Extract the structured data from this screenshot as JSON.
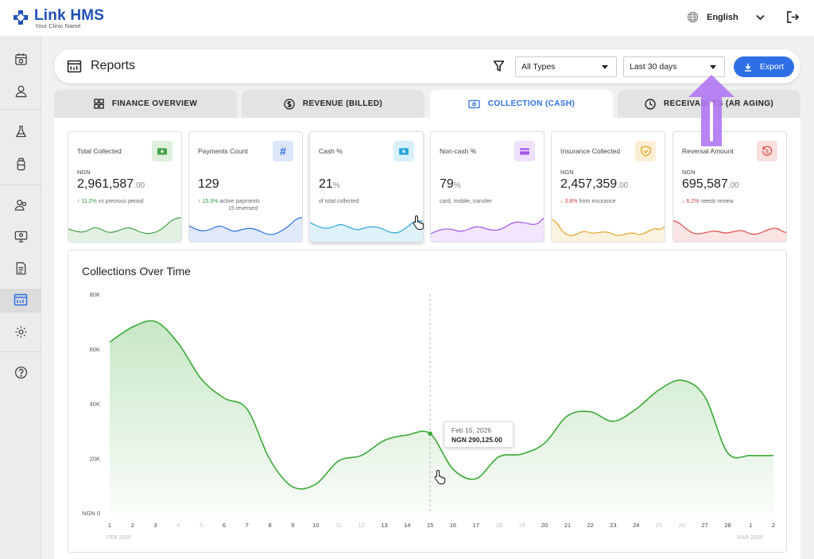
{
  "app": {
    "name": "Link HMS",
    "tagline": "Your Clinic Name"
  },
  "topbar": {
    "language": "English"
  },
  "sidebar": {
    "items": [
      {
        "name": "calendar-icon"
      },
      {
        "name": "user-icon"
      },
      {
        "name": "flask-icon"
      },
      {
        "name": "bottle-icon"
      },
      {
        "name": "users-icon"
      },
      {
        "name": "monitor-icon"
      },
      {
        "name": "document-icon"
      },
      {
        "name": "reports-icon",
        "active": true
      },
      {
        "name": "settings-icon"
      },
      {
        "name": "help-icon"
      }
    ]
  },
  "header": {
    "title": "Reports",
    "type_filter": "All Types",
    "date_filter": "Last 30 days",
    "export_label": "Export"
  },
  "tabs": [
    {
      "label": "FINANCE OVERVIEW"
    },
    {
      "label": "REVENUE (BILLED)"
    },
    {
      "label": "COLLECTION (CASH)",
      "active": true
    },
    {
      "label": "RECEIVABLES (AR AGING)"
    }
  ],
  "kpis": [
    {
      "label": "Total Collected",
      "currency": "NGN",
      "value": "2,961,587",
      "decimal": ".00",
      "change": "11.2%",
      "direction": "up",
      "note": "vs previous period",
      "color": "#43a047",
      "icon": "cash-icon"
    },
    {
      "label": "Payments Count",
      "currency": "",
      "value": "129",
      "decimal": "",
      "change": "15.3%",
      "direction": "up",
      "note": "active payments ·",
      "note2": "15 reversed",
      "color": "#2e6fe6",
      "icon": "hash-icon"
    },
    {
      "label": "Cash %",
      "currency": "",
      "value": "21",
      "decimal": "%",
      "change": "",
      "direction": "",
      "note": "of total collected",
      "color": "#29a5de",
      "icon": "cash-icon"
    },
    {
      "label": "Non-cash %",
      "currency": "",
      "value": "79",
      "decimal": "%",
      "change": "",
      "direction": "",
      "note": "card, mobile, transfer",
      "color": "#a256e6",
      "icon": "card-icon"
    },
    {
      "label": "Insurance Collected",
      "currency": "NGN",
      "value": "2,457,359",
      "decimal": ".00",
      "change": "3.8%",
      "direction": "down",
      "note": "from insurance",
      "color": "#e6a52b",
      "icon": "shield-icon"
    },
    {
      "label": "Reversal Amount",
      "currency": "NGN",
      "value": "695,587",
      "decimal": ".00",
      "change": "6.2%",
      "direction": "down",
      "note": "needs review",
      "color": "#e04848",
      "icon": "refund-icon"
    }
  ],
  "chart_data": {
    "type": "area",
    "title": "Collections Over Time",
    "ylabel": "",
    "xlabel": "",
    "yticks": [
      "NGN 0",
      "20K",
      "40K",
      "60K",
      "80K"
    ],
    "ylim": [
      0,
      80000
    ],
    "x": [
      "1",
      "2",
      "3",
      "4",
      "5",
      "6",
      "7",
      "8",
      "9",
      "10",
      "11",
      "12",
      "13",
      "14",
      "15",
      "16",
      "17",
      "18",
      "19",
      "20",
      "21",
      "22",
      "23",
      "24",
      "25",
      "26",
      "27",
      "28",
      "1",
      "2"
    ],
    "x_muted": [
      4,
      5,
      11,
      12,
      18,
      19,
      25,
      26
    ],
    "x_group_labels": [
      {
        "label": "FEB 2026",
        "position": "left"
      },
      {
        "label": "MAR 2026",
        "position": "right"
      }
    ],
    "series": [
      {
        "color": "#3aa935",
        "values": [
          62500,
          68000,
          70000,
          62000,
          49000,
          42000,
          38000,
          19500,
          9500,
          10500,
          19000,
          21000,
          26500,
          28500,
          29000,
          16000,
          12500,
          20500,
          21500,
          25500,
          35500,
          37000,
          33500,
          38000,
          45000,
          48500,
          42500,
          22000,
          21000,
          21000
        ]
      }
    ],
    "tooltip": {
      "date": "Feb 15, 2026",
      "value": "NGN 290,125.00"
    },
    "grid": false,
    "hover_index": 14
  },
  "colors": {
    "accent": "#2e6fe6",
    "annotation_arrow": "#b077f2"
  }
}
